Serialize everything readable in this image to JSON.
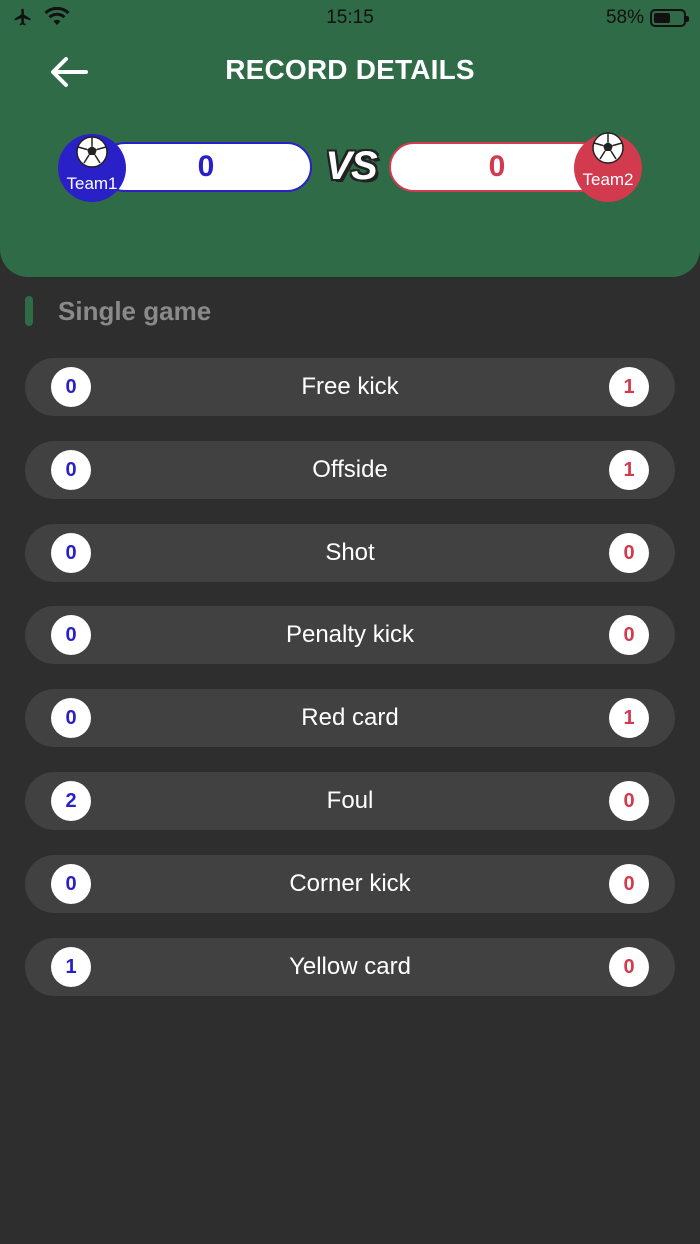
{
  "status_bar": {
    "time": "15:15",
    "battery": "58%",
    "battery_level": 0.58
  },
  "header": {
    "title": "RECORD DETAILS"
  },
  "team1": {
    "name": "Team1",
    "score": "0",
    "color": "#2a20c8"
  },
  "team2": {
    "name": "Team2",
    "score": "0",
    "color": "#d23b4e"
  },
  "vs_label": "VS",
  "section": {
    "title": "Single game"
  },
  "stats": [
    {
      "label": "Free kick",
      "team1": "0",
      "team2": "1"
    },
    {
      "label": "Offside",
      "team1": "0",
      "team2": "1"
    },
    {
      "label": "Shot",
      "team1": "0",
      "team2": "0"
    },
    {
      "label": "Penalty kick",
      "team1": "0",
      "team2": "0"
    },
    {
      "label": "Red card",
      "team1": "0",
      "team2": "1"
    },
    {
      "label": "Foul",
      "team1": "2",
      "team2": "0"
    },
    {
      "label": "Corner kick",
      "team1": "0",
      "team2": "0"
    },
    {
      "label": "Yellow card",
      "team1": "1",
      "team2": "0"
    }
  ],
  "colors": {
    "header": "#2f6b47",
    "background": "#2e2e2e",
    "row": "#414141"
  }
}
